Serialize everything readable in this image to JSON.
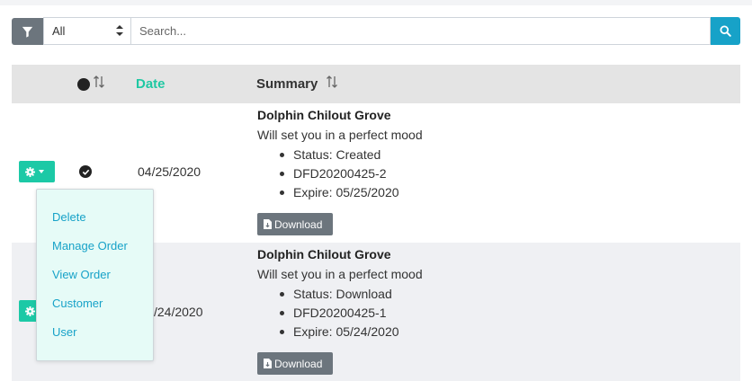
{
  "toolbar": {
    "filter_select_value": "All",
    "search_placeholder": "Search..."
  },
  "table": {
    "headers": {
      "date": "Date",
      "summary": "Summary"
    },
    "rows": [
      {
        "date": "04/25/2020",
        "title": "Dolphin Chilout Grove",
        "description": "Will set you in a perfect mood",
        "details": [
          "Status: Created",
          "DFD20200425-2",
          "Expire: 05/25/2020"
        ],
        "download_label": "Download"
      },
      {
        "date": "/24/2020",
        "title": "Dolphin Chilout Grove",
        "description": "Will set you in a perfect mood",
        "details": [
          "Status: Download",
          "DFD20200425-1",
          "Expire: 05/24/2020"
        ],
        "download_label": "Download"
      }
    ]
  },
  "action_menu": {
    "items": [
      "Delete",
      "Manage Order",
      "View Order",
      "Customer",
      "User"
    ]
  },
  "colors": {
    "accent": "#1cc9a6",
    "link": "#17a2c8",
    "secondary": "#6c757d"
  }
}
